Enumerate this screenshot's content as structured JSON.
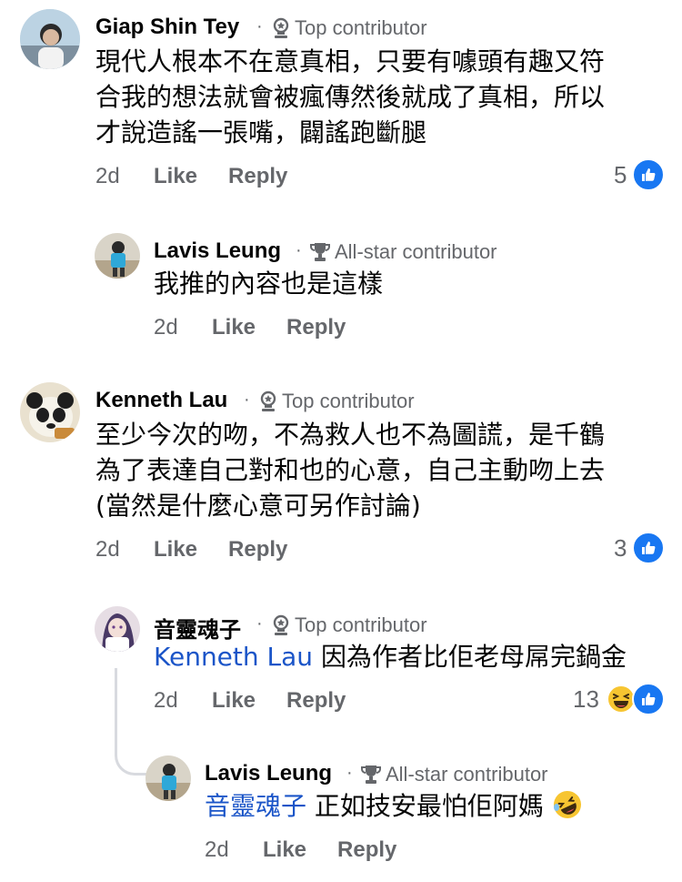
{
  "comments": [
    {
      "name": "Giap Shin Tey",
      "badge": "Top contributor",
      "text_lines": [
        "現代人根本不在意真相，只要有噱頭有趣又符",
        "合我的想法就會被瘋傳然後就成了真相，所以",
        "才說造謠一張嘴，闢謠跑斷腿"
      ],
      "time": "2d",
      "like": "Like",
      "reply": "Reply",
      "reactions": "5",
      "reaction_icons": [
        "like-icon"
      ]
    },
    {
      "name": "Lavis Leung",
      "badge": "All-star contributor",
      "text_lines": [
        "我推的內容也是這樣"
      ],
      "time": "2d",
      "like": "Like",
      "reply": "Reply"
    },
    {
      "name": "Kenneth Lau",
      "badge": "Top contributor",
      "text_lines": [
        "至少今次的吻，不為救人也不為圖謊，是千鶴",
        "為了表達自己對和也的心意，自己主動吻上去",
        "(當然是什麼心意可另作討論)"
      ],
      "time": "2d",
      "like": "Like",
      "reply": "Reply",
      "reactions": "3",
      "reaction_icons": [
        "like-icon"
      ]
    },
    {
      "name": "音靈魂子",
      "badge": "Top contributor",
      "mention": "Kenneth Lau",
      "text": "因為作者比佢老母屌完鍋金",
      "time": "2d",
      "like": "Like",
      "reply": "Reply",
      "reactions": "13",
      "reaction_icons": [
        "haha-icon",
        "like-icon"
      ]
    },
    {
      "name": "Lavis Leung",
      "badge": "All-star contributor",
      "mention": "音靈魂子",
      "text": "正如技安最怕佢阿媽",
      "trailing_emoji": "rofl-emoji-icon",
      "time": "2d",
      "like": "Like",
      "reply": "Reply"
    }
  ],
  "separator": "·",
  "colors": {
    "mention": "#1b55c8",
    "like_blue": "#1877f2",
    "muted": "#65676b"
  }
}
